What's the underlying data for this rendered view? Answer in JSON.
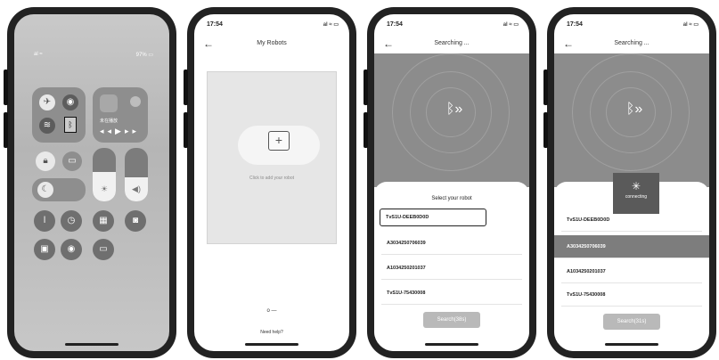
{
  "phone1": {
    "status_left": "al ≈",
    "status_right": "97% ▭",
    "media_label": "未在播放",
    "icons": [
      "airplane-icon",
      "cellular-icon",
      "wifi-icon",
      "bluetooth-icon",
      "screen-lock-icon",
      "mirror-icon",
      "brightness-icon",
      "volume-icon",
      "moon-icon",
      "flashlight-icon",
      "timer-icon",
      "calculator-icon",
      "camera-icon",
      "qr-icon",
      "record-icon",
      "battery-icon"
    ],
    "brightness_level": 0.55,
    "volume_level": 0.45
  },
  "phone2": {
    "time": "17:54",
    "title": "My Robots",
    "add_prompt": "Click to add your robot",
    "pager": "o —",
    "help": "Need help?"
  },
  "phone3": {
    "time": "17:54",
    "title": "Searching ...",
    "sheet_title": "Select your robot",
    "items": [
      "TvS1U-DEEB0D0D",
      "A3034250706039",
      "A1034250201037",
      "TvS1U-75430008"
    ],
    "search_button": "Search(38s)"
  },
  "phone4": {
    "time": "17:54",
    "title": "Searching ...",
    "items": [
      "TvS1U-DEEB0D0D",
      "A3034250706039",
      "A1034250201037",
      "TvS1U-75430008"
    ],
    "popup_text": "connecting",
    "search_button": "Search(31s)"
  },
  "colors": {
    "radar": "#8c8c8c",
    "selected_row": "#7d7d7d",
    "button": "#b9b9b9"
  }
}
